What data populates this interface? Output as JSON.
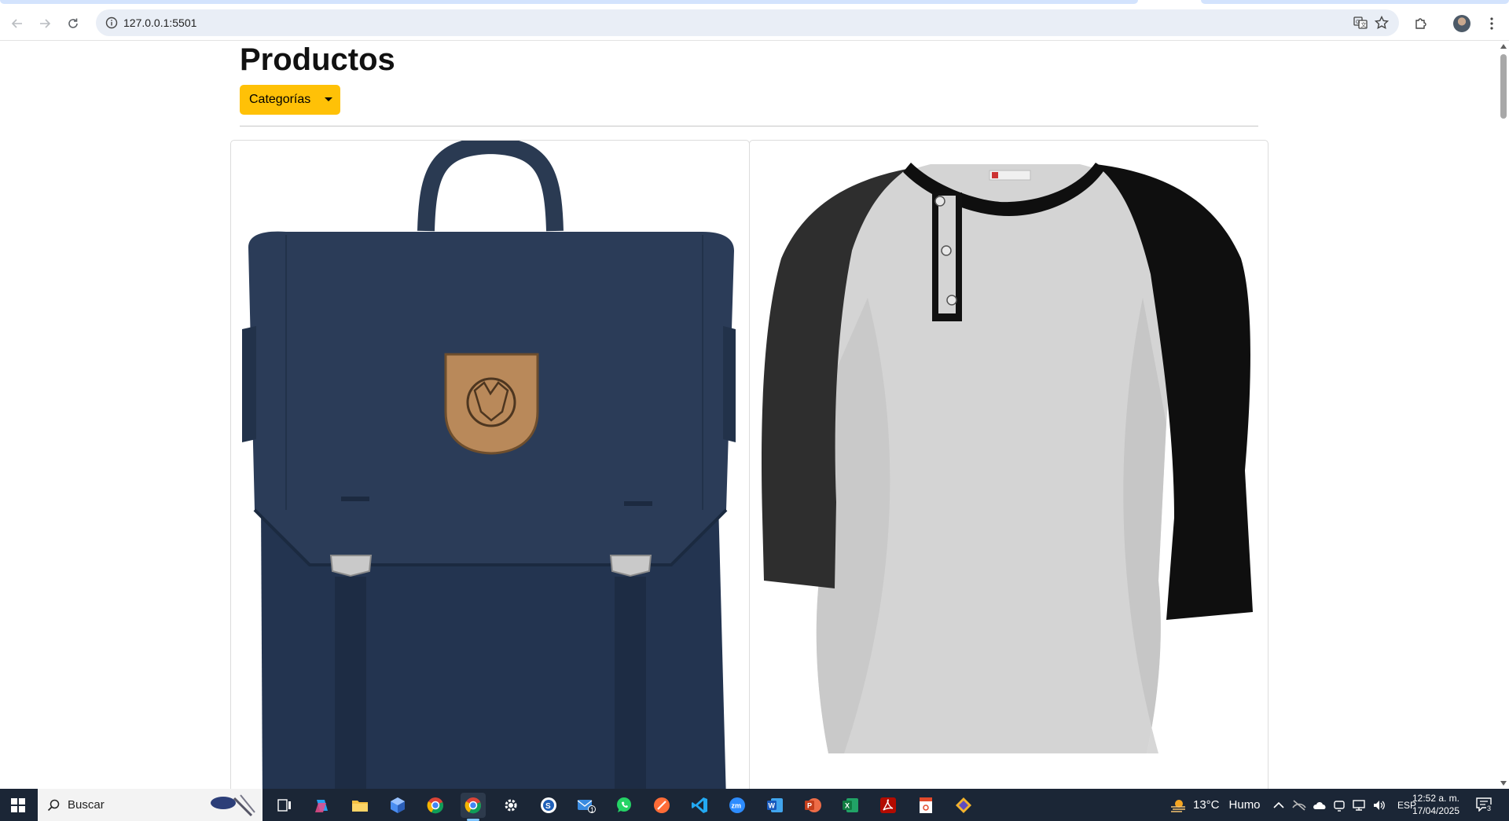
{
  "browser": {
    "url": "127.0.0.1:5501",
    "back_icon": "arrow-left-icon",
    "forward_icon": "arrow-right-icon",
    "reload_icon": "reload-icon"
  },
  "page": {
    "title": "Productos",
    "dropdown_label": "Categorías",
    "accent_color": "#ffc107"
  },
  "products": [
    {
      "image": "navy-backpack"
    },
    {
      "image": "raglan-henley-shirt"
    }
  ],
  "taskbar": {
    "search_placeholder": "Buscar",
    "weather_temp": "13°C",
    "weather_desc": "Humo",
    "language": "ESP",
    "time": "12:52 a. m.",
    "date": "17/04/2025",
    "notification_count": "3",
    "mail_badge": "1"
  }
}
